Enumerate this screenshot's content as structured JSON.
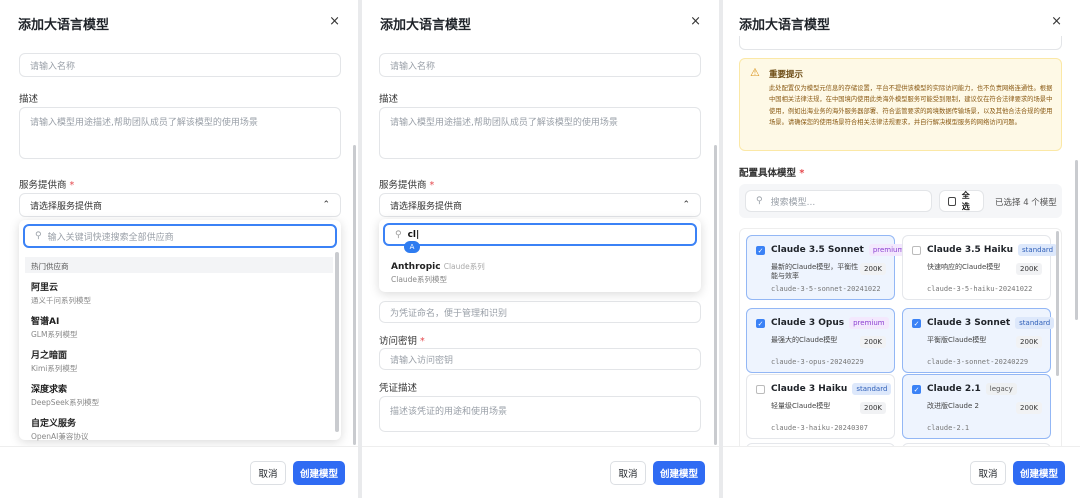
{
  "dialog_title": "添加大语言模型",
  "close_icon": "×",
  "name_placeholder": "请输入名称",
  "desc_label": "描述",
  "desc_placeholder": "请输入模型用途描述,帮助团队成员了解该模型的使用场景",
  "provider_label": "服务提供商",
  "provider_placeholder": "请选择服务提供商",
  "required_mark": "*",
  "cancel_label": "取消",
  "create_label": "创建模型",
  "panel1": {
    "search_placeholder": "输入关键词快速搜索全部供应商",
    "group_label": "热门供应商",
    "providers": [
      {
        "name": "阿里云",
        "desc": "通义千问系列模型"
      },
      {
        "name": "智谱AI",
        "desc": "GLM系列模型"
      },
      {
        "name": "月之暗面",
        "desc": "Kimi系列模型"
      },
      {
        "name": "深度求索",
        "desc": "DeepSeek系列模型"
      },
      {
        "name": "自定义服务",
        "desc": "OpenAI兼容协议"
      }
    ]
  },
  "panel2": {
    "search_value": "cl",
    "cursor_badge": "A",
    "result": {
      "name": "Anthropic",
      "tag": "Claude系列",
      "desc": "Claude系列模型"
    },
    "cred_name_placeholder": "为凭证命名，便于管理和识别",
    "key_label": "访问密钥",
    "key_placeholder": "请输入访问密钥",
    "cred_desc_label": "凭证描述",
    "cred_desc_placeholder": "描述该凭证的用途和使用场景"
  },
  "panel3": {
    "warning_title": "重要提示",
    "warning_text": "此处配置仅为模型元信息的存储设置，平台不提供该模型的实际访问能力，也不负责网络连通性。根据中国相关法律法规，在中国境内使用此类海外模型服务可能受到限制，建议仅在符合法律要求的场景中使用，例如出海业务的海外服务器部署、符合监管要求的跨境数据传输场景，以及其他合法合规的使用场景。请确保您的使用场景符合相关法律法规要求，并自行解决模型服务的网络访问问题。",
    "models_label": "配置具体模型",
    "search_placeholder": "搜索模型...",
    "select_all": "全选",
    "selected_count": "已选择 4 个模型",
    "models": [
      {
        "name": "Claude 3.5 Sonnet",
        "tier": "premium",
        "desc": "最新的Claude模型，平衡性能与效率",
        "context": "200K",
        "id": "claude-3-5-sonnet-20241022",
        "selected": true
      },
      {
        "name": "Claude 3.5 Haiku",
        "tier": "standard",
        "desc": "快速响应的Claude模型",
        "context": "200K",
        "id": "claude-3-5-haiku-20241022",
        "selected": false
      },
      {
        "name": "Claude 3 Opus",
        "tier": "premium",
        "desc": "最强大的Claude模型",
        "context": "200K",
        "id": "claude-3-opus-20240229",
        "selected": true
      },
      {
        "name": "Claude 3 Sonnet",
        "tier": "standard",
        "desc": "平衡版Claude模型",
        "context": "200K",
        "id": "claude-3-sonnet-20240229",
        "selected": true
      },
      {
        "name": "Claude 3 Haiku",
        "tier": "standard",
        "desc": "轻量级Claude模型",
        "context": "200K",
        "id": "claude-3-haiku-20240307",
        "selected": false
      },
      {
        "name": "Claude 2.1",
        "tier": "legacy",
        "desc": "改进版Claude 2",
        "context": "200K",
        "id": "claude-2.1",
        "selected": true
      }
    ]
  },
  "colors": {
    "primary": "#2f6bf3",
    "warning_bg": "#fef9e6",
    "required": "#e5484d"
  }
}
